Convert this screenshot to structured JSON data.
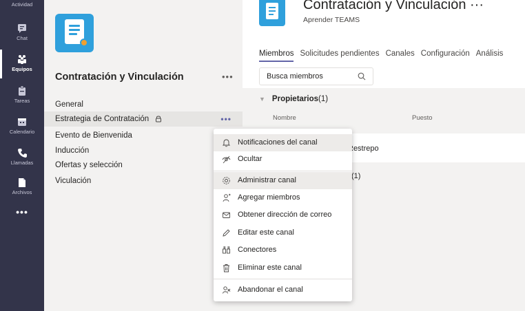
{
  "rail": {
    "items": [
      {
        "label": "Actividad",
        "icon": "bell-icon"
      },
      {
        "label": "Chat",
        "icon": "chat-icon"
      },
      {
        "label": "Equipos",
        "icon": "teams-icon"
      },
      {
        "label": "Tareas",
        "icon": "tasks-icon"
      },
      {
        "label": "Calendario",
        "icon": "calendar-icon"
      },
      {
        "label": "Llamadas",
        "icon": "phone-icon"
      },
      {
        "label": "Archivos",
        "icon": "file-icon"
      }
    ],
    "more": "•••"
  },
  "panel": {
    "team_name": "Contratación y Vinculación",
    "more": "•••",
    "channels": [
      {
        "label": "General"
      },
      {
        "label": "Estrategia de Contratación",
        "more": "•••"
      },
      {
        "label": "Evento de Bienvenida"
      },
      {
        "label": "Inducción"
      },
      {
        "label": "Ofertas y selección"
      },
      {
        "label": "Viculación"
      }
    ]
  },
  "header": {
    "title": "Contratación y Vinculación ···",
    "subtitle": "Aprender TEAMS",
    "tabs": [
      "Miembros",
      "Solicitudes pendientes",
      "Canales",
      "Configuración",
      "Análisis"
    ]
  },
  "search": {
    "placeholder": "Busca miembros"
  },
  "owners": {
    "title": "Propietarios",
    "count": "(1)"
  },
  "table": {
    "col_name": "Nombre",
    "col_role": "Puesto",
    "row_text": "Restrepo"
  },
  "members_count": "(1)",
  "menu": {
    "items": [
      {
        "label": "Notificaciones del canal",
        "icon": "bell-icon"
      },
      {
        "label": "Ocultar",
        "icon": "eye-off-icon"
      },
      {
        "label": "Administrar canal",
        "icon": "gear-icon"
      },
      {
        "label": "Agregar miembros",
        "icon": "add-person-icon"
      },
      {
        "label": "Obtener dirección de correo",
        "icon": "mail-icon"
      },
      {
        "label": "Editar este canal",
        "icon": "pencil-icon"
      },
      {
        "label": "Conectores",
        "icon": "connectors-icon"
      },
      {
        "label": "Eliminar este canal",
        "icon": "trash-icon"
      },
      {
        "label": "Abandonar el canal",
        "icon": "leave-icon"
      }
    ]
  },
  "colors": {
    "rail": "#33344a",
    "accent": "#6264a7",
    "team_icon": "#2fa0dc"
  }
}
